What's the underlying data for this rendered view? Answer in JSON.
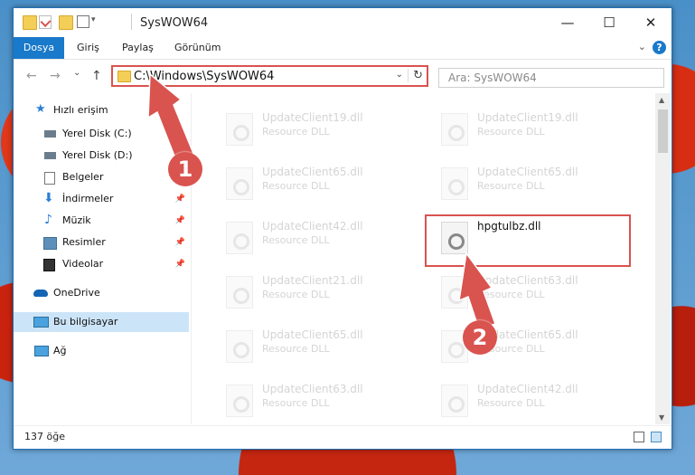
{
  "window": {
    "title": "SysWOW64",
    "controls": {
      "minimize": "—",
      "maximize": "☐",
      "close": "✕"
    }
  },
  "ribbon": {
    "tabs": [
      "Dosya",
      "Giriş",
      "Paylaş",
      "Görünüm"
    ],
    "help": "?",
    "collapse": "⌄"
  },
  "nav": {
    "back": "←",
    "forward": "→",
    "recent": "⌄",
    "up": "↑",
    "address": "C:\\Windows\\SysWOW64",
    "address_dropdown": "⌄",
    "refresh": "↻",
    "search_placeholder": "Ara: SysWOW64"
  },
  "sidebar": {
    "items": [
      {
        "label": "Hızlı erişim",
        "icon": "star-icon",
        "pin": ""
      },
      {
        "label": "Yerel Disk (C:)",
        "icon": "drive-icon",
        "pin": "📌"
      },
      {
        "label": "Yerel Disk (D:)",
        "icon": "drive-icon",
        "pin": ""
      },
      {
        "label": "Belgeler",
        "icon": "document-icon",
        "pin": ""
      },
      {
        "label": "İndirmeler",
        "icon": "download-icon",
        "pin": "📌"
      },
      {
        "label": "Müzik",
        "icon": "music-icon",
        "pin": "📌"
      },
      {
        "label": "Resimler",
        "icon": "pictures-icon",
        "pin": "📌"
      },
      {
        "label": "Videolar",
        "icon": "video-icon",
        "pin": "📌"
      },
      {
        "label": "OneDrive",
        "icon": "cloud-icon",
        "pin": ""
      },
      {
        "label": "Bu bilgisayar",
        "icon": "computer-icon",
        "pin": ""
      },
      {
        "label": "Ağ",
        "icon": "network-icon",
        "pin": ""
      }
    ]
  },
  "files": {
    "left": [
      {
        "name": "UpdateClient19.dll",
        "type": "Resource DLL"
      },
      {
        "name": "UpdateClient65.dll",
        "type": "Resource DLL"
      },
      {
        "name": "UpdateClient42.dll",
        "type": "Resource DLL"
      },
      {
        "name": "UpdateClient21.dll",
        "type": "Resource DLL"
      },
      {
        "name": "UpdateClient65.dll",
        "type": "Resource DLL"
      },
      {
        "name": "UpdateClient63.dll",
        "type": "Resource DLL"
      }
    ],
    "right": [
      {
        "name": "UpdateClient19.dll",
        "type": "Resource DLL"
      },
      {
        "name": "UpdateClient65.dll",
        "type": "Resource DLL"
      },
      {
        "name": "hpgtulbz.dll",
        "type": ""
      },
      {
        "name": "UpdateClient63.dll",
        "type": "Resource DLL"
      },
      {
        "name": "UpdateClient65.dll",
        "type": "Resource DLL"
      },
      {
        "name": "UpdateClient42.dll",
        "type": "Resource DLL"
      }
    ]
  },
  "status": {
    "count": "137 öğe"
  },
  "annotations": {
    "step1": "1",
    "step2": "2"
  },
  "colors": {
    "accent": "#1979ca",
    "highlight": "#d9534f",
    "selection": "#cce4f7"
  }
}
